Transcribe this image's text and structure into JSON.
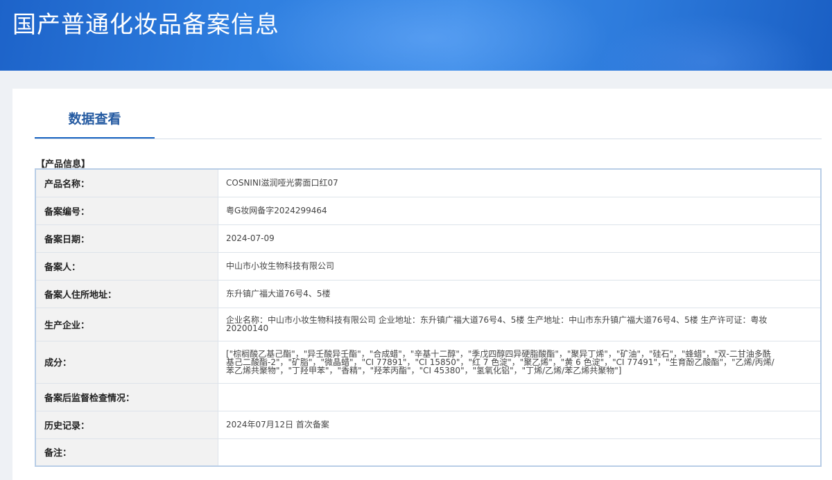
{
  "header": {
    "title": "国产普通化妆品备案信息"
  },
  "tabs": [
    {
      "label": "数据查看",
      "active": true
    }
  ],
  "section": {
    "title": "【产品信息】"
  },
  "rows": [
    {
      "label": "产品名称：",
      "value": "COSNINI滋润哑光雾面口红07"
    },
    {
      "label": "备案编号：",
      "value": "粤G妆网备字2024299464"
    },
    {
      "label": "备案日期：",
      "value": "2024-07-09"
    },
    {
      "label": "备案人：",
      "value": "中山市小妆生物科技有限公司"
    },
    {
      "label": "备案人住所地址：",
      "value": "东升镇广福大道76号4、5楼"
    },
    {
      "label": "生产企业：",
      "value": "企业名称：中山市小妆生物科技有限公司 企业地址：东升镇广福大道76号4、5楼 生产地址：中山市东升镇广福大道76号4、5楼 生产许可证：粤妆20200140"
    },
    {
      "label": "成分：",
      "value": "[\"棕榈酸乙基己酯\"，\"异壬酸异壬酯\"，\"合成蜡\"，\"辛基十二醇\"，\"季戊四醇四异硬脂酸酯\"，\"聚异丁烯\"，\"矿油\"，\"硅石\"，\"蜂蜡\"，\"双-二甘油多酰基己二酸酯-2\"，\"矿脂\"，\"微晶蜡\"，\"CI 77891\"，\"CI 15850\"，\"红 7 色淀\"，\"聚乙烯\"，\"黄 6 色淀\"，\"CI 77491\"，\"生育酚乙酸酯\"，\"乙烯/丙烯/苯乙烯共聚物\"，\"丁羟甲苯\"，\"香精\"，\"羟苯丙酯\"，\"CI 45380\"，\"氢氧化铝\"，\"丁烯/乙烯/苯乙烯共聚物\"]"
    },
    {
      "label": "备案后监督检查情况：",
      "value": ""
    },
    {
      "label": "历史记录：",
      "value": "2024年07月12日 首次备案"
    },
    {
      "label": "备注：",
      "value": ""
    }
  ],
  "colors": {
    "banner": "#2f7fe0",
    "tab_accent": "#1a64c2",
    "tab_text": "#245aa1",
    "label_bg": "#f2f2f2",
    "table_border": "#b8cde6"
  }
}
